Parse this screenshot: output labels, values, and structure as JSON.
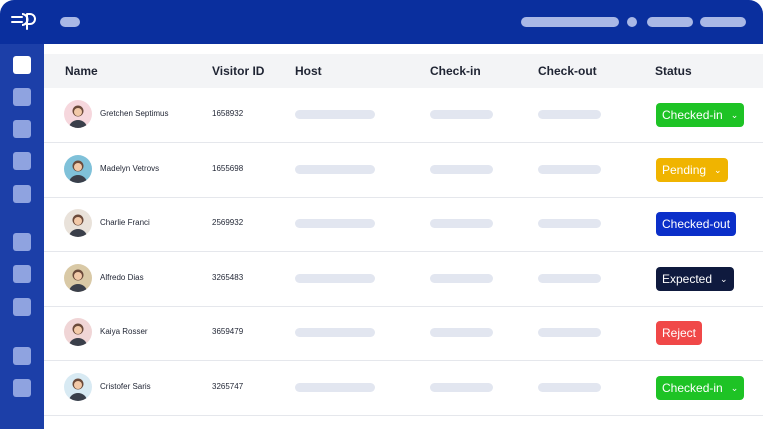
{
  "table": {
    "columns": [
      "Name",
      "Visitor ID",
      "Host",
      "Check-in",
      "Check-out",
      "Status"
    ],
    "rows": [
      {
        "name": "Gretchen Septimus",
        "visitor_id": "1658932",
        "status": "Checked-in",
        "status_color": "#1ec325",
        "dropdown": true,
        "avatar_bg": "#f6d7dd"
      },
      {
        "name": "Madelyn Vetrovs",
        "visitor_id": "1655698",
        "status": "Pending",
        "status_color": "#f0b400",
        "dropdown": true,
        "avatar_bg": "#7fc1d9"
      },
      {
        "name": "Charlie Franci",
        "visitor_id": "2569932",
        "status": "Checked-out",
        "status_color": "#0b2fc9",
        "dropdown": false,
        "avatar_bg": "#e9e2da"
      },
      {
        "name": "Alfredo Dias",
        "visitor_id": "3265483",
        "status": "Expected",
        "status_color": "#0f1a3e",
        "dropdown": true,
        "avatar_bg": "#d9c9a6"
      },
      {
        "name": "Kaiya Rosser",
        "visitor_id": "3659479",
        "status": "Reject",
        "status_color": "#f04848",
        "dropdown": false,
        "avatar_bg": "#f0d5d6"
      },
      {
        "name": "Cristofer Saris",
        "visitor_id": "3265747",
        "status": "Checked-in",
        "status_color": "#1ec325",
        "dropdown": true,
        "avatar_bg": "#d8eaf3"
      }
    ]
  },
  "colors": {
    "topbar": "#0a2f9e",
    "sidebar": "#1c3fa8",
    "placeholder": "#e2e6f0"
  },
  "icons": [
    "logo-icon",
    "avatar",
    "chevron-down-icon"
  ]
}
